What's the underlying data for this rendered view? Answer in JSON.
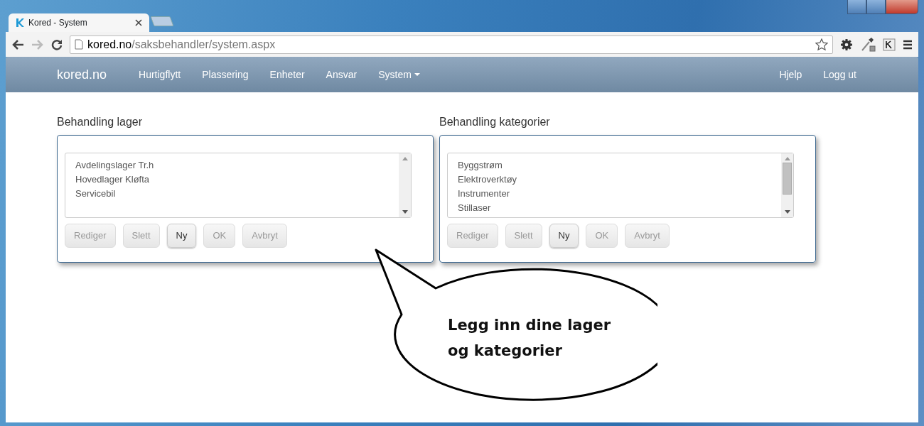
{
  "browser": {
    "tab_title": "Kored - System",
    "address": {
      "host": "kored.no",
      "path": "/saksbehandler/system.aspx"
    },
    "forward_disabled": true
  },
  "navbar": {
    "brand": "kored.no",
    "items": [
      {
        "label": "Hurtigflytt",
        "dropdown": false
      },
      {
        "label": "Plassering",
        "dropdown": false
      },
      {
        "label": "Enheter",
        "dropdown": false
      },
      {
        "label": "Ansvar",
        "dropdown": false
      },
      {
        "label": "System",
        "dropdown": true
      }
    ],
    "right_items": [
      "Hjelp",
      "Logg ut"
    ]
  },
  "panels": [
    {
      "title": "Behandling lager",
      "items": [
        "Avdelingslager Tr.h",
        "Hovedlager Kløfta",
        "Servicebil"
      ],
      "scrollable": false,
      "buttons": [
        {
          "label": "Rediger",
          "disabled": true
        },
        {
          "label": "Slett",
          "disabled": true
        },
        {
          "label": "Ny",
          "disabled": false
        },
        {
          "label": "OK",
          "disabled": true
        },
        {
          "label": "Avbryt",
          "disabled": true
        }
      ]
    },
    {
      "title": "Behandling kategorier",
      "items": [
        "Byggstrøm",
        "Elektroverktøy",
        "Instrumenter",
        "Stillaser"
      ],
      "scrollable": true,
      "buttons": [
        {
          "label": "Rediger",
          "disabled": true
        },
        {
          "label": "Slett",
          "disabled": true
        },
        {
          "label": "Ny",
          "disabled": false
        },
        {
          "label": "OK",
          "disabled": true
        },
        {
          "label": "Avbryt",
          "disabled": true
        }
      ]
    }
  ],
  "callout": {
    "text": "Legg inn dine lager og kategorier"
  }
}
